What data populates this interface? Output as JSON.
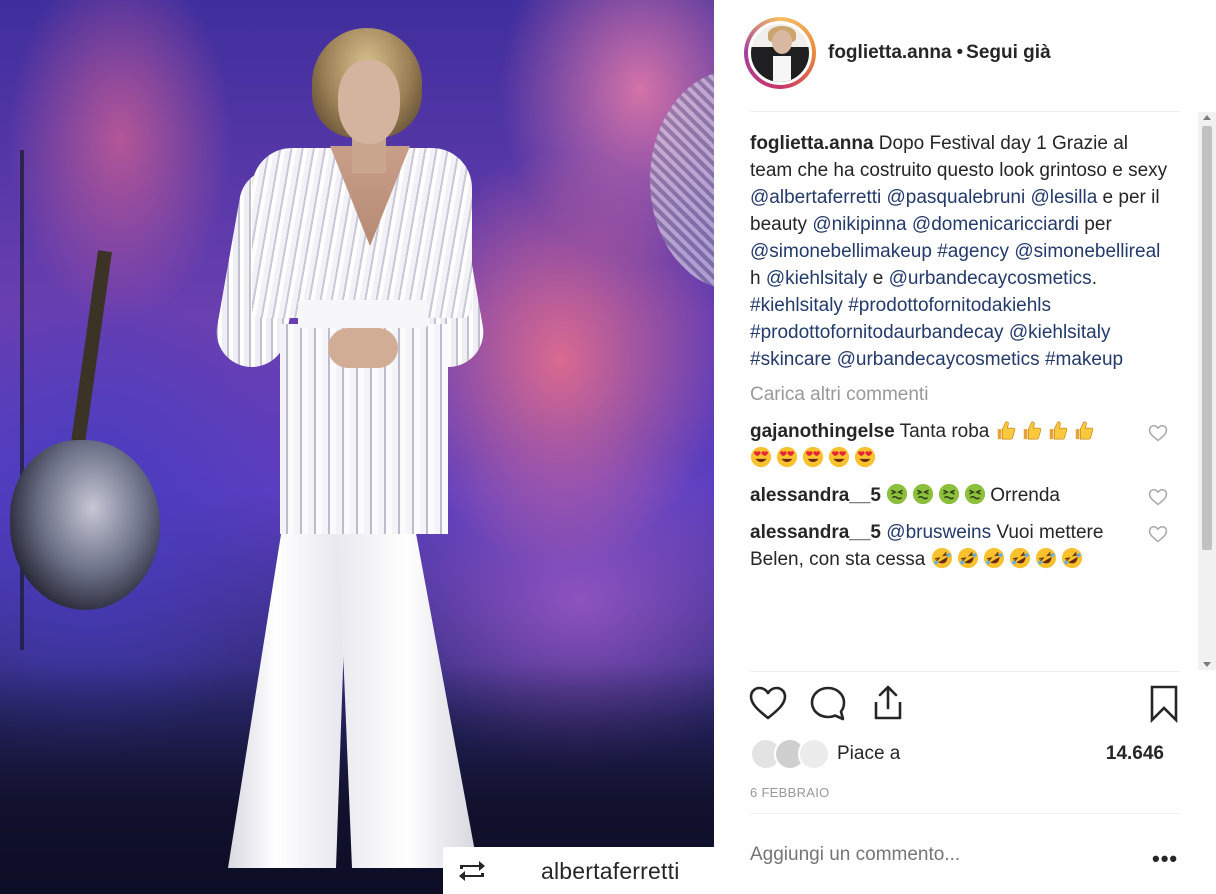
{
  "post": {
    "username": "foglietta.anna",
    "separator": "•",
    "follow_label": "Segui già"
  },
  "photo": {
    "repost_handle": "albertaferretti"
  },
  "caption": {
    "username": "foglietta.anna",
    "segments": [
      {
        "text": "Dopo Festival day 1 Grazie al team che ha costruito questo look grintoso e sexy ",
        "tag": false
      },
      {
        "text": "@albertaferretti",
        "tag": true
      },
      {
        "text": " ",
        "tag": false
      },
      {
        "text": "@pasqualebruni",
        "tag": true
      },
      {
        "text": " ",
        "tag": false
      },
      {
        "text": "@lesilla",
        "tag": true
      },
      {
        "text": " e per il beauty ",
        "tag": false
      },
      {
        "text": "@nikipinna",
        "tag": true
      },
      {
        "text": " ",
        "tag": false
      },
      {
        "text": "@domenicaricciardi",
        "tag": true
      },
      {
        "text": " per ",
        "tag": false
      },
      {
        "text": "@simonebellimakeup",
        "tag": true
      },
      {
        "text": " ",
        "tag": false
      },
      {
        "text": "#agency",
        "tag": true
      },
      {
        "text": " ",
        "tag": false
      },
      {
        "text": "@simonebellireal",
        "tag": true
      },
      {
        "text": " h ",
        "tag": false
      },
      {
        "text": "@kiehlsitaly",
        "tag": true
      },
      {
        "text": " e ",
        "tag": false
      },
      {
        "text": "@urbandecaycosmetics",
        "tag": true
      },
      {
        "text": ". ",
        "tag": false
      },
      {
        "text": "#kiehlsitaly",
        "tag": true
      },
      {
        "text": " ",
        "tag": false
      },
      {
        "text": "#prodottofornitodakiehls",
        "tag": true
      },
      {
        "text": " ",
        "tag": false
      },
      {
        "text": "#prodottofornitodaurbandecay",
        "tag": true
      },
      {
        "text": " ",
        "tag": false
      },
      {
        "text": "@kiehlsitaly",
        "tag": true
      },
      {
        "text": " ",
        "tag": false
      },
      {
        "text": "#skincare",
        "tag": true
      },
      {
        "text": " ",
        "tag": false
      },
      {
        "text": "@urbandecaycosmetics",
        "tag": true
      },
      {
        "text": " ",
        "tag": false
      },
      {
        "text": "#makeup",
        "tag": true
      }
    ]
  },
  "load_more_label": "Carica altri commenti",
  "comments": [
    {
      "username": "gajanothingelse",
      "parts": [
        {
          "text": "Tanta roba "
        },
        {
          "emoji": "thumbs-up",
          "count": 4
        },
        {
          "emoji": "heart-eyes",
          "count": 5
        }
      ]
    },
    {
      "username": "alessandra__5",
      "parts": [
        {
          "text": " "
        },
        {
          "emoji": "nauseated",
          "count": 4
        },
        {
          "text": "Orrenda"
        }
      ]
    },
    {
      "username": "alessandra__5",
      "parts": [
        {
          "tag": "@brusweins"
        },
        {
          "text": " Vuoi mettere Belen, con sta cessa "
        },
        {
          "emoji": "rofl",
          "count": 6
        }
      ]
    }
  ],
  "likes": {
    "prefix": "Piace a",
    "count": "14.646"
  },
  "date": "6 FEBBRAIO",
  "add_comment_placeholder": "Aggiungi un commento...",
  "more_label": "•••",
  "colors": {
    "tag": "#233a6b",
    "muted": "#999999",
    "text": "#262626"
  }
}
